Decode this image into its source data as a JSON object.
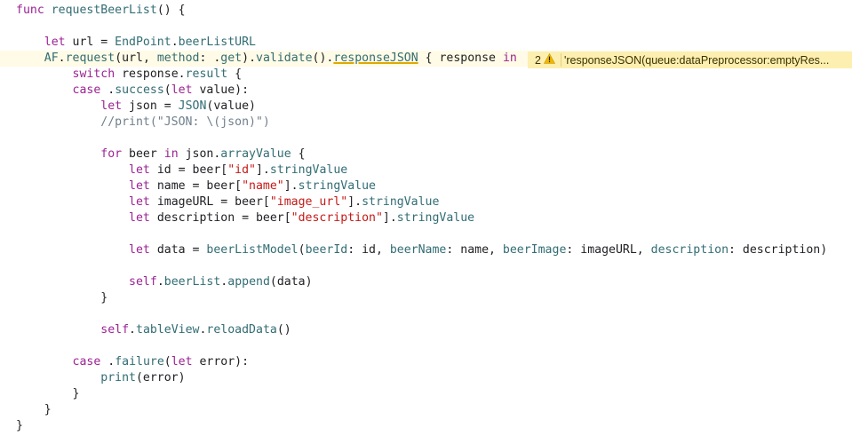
{
  "code_lines": [
    [
      [
        "kw",
        "func"
      ],
      [
        "p",
        " "
      ],
      [
        "fn",
        "requestBeerList"
      ],
      [
        "p",
        "() {"
      ]
    ],
    [],
    [
      [
        "p",
        "    "
      ],
      [
        "kw",
        "let"
      ],
      [
        "p",
        " url = "
      ],
      [
        "fn",
        "EndPoint"
      ],
      [
        "p",
        "."
      ],
      [
        "fn",
        "beerListURL"
      ]
    ],
    [
      [
        "p",
        "    "
      ],
      [
        "fn",
        "AF"
      ],
      [
        "p",
        "."
      ],
      [
        "fn",
        "request"
      ],
      [
        "p",
        "(url, "
      ],
      [
        "fn",
        "method"
      ],
      [
        "p",
        ": ."
      ],
      [
        "fn",
        "get"
      ],
      [
        "p",
        ")."
      ],
      [
        "fn",
        "validate"
      ],
      [
        "p",
        "()."
      ],
      [
        "fnw",
        "responseJSON"
      ],
      [
        "p",
        " { response "
      ],
      [
        "kw",
        "in"
      ]
    ],
    [
      [
        "p",
        "        "
      ],
      [
        "kw",
        "switch"
      ],
      [
        "p",
        " response."
      ],
      [
        "fn",
        "result"
      ],
      [
        "p",
        " {"
      ]
    ],
    [
      [
        "p",
        "        "
      ],
      [
        "kw",
        "case"
      ],
      [
        "p",
        " ."
      ],
      [
        "fn",
        "success"
      ],
      [
        "p",
        "("
      ],
      [
        "kw",
        "let"
      ],
      [
        "p",
        " value):"
      ]
    ],
    [
      [
        "p",
        "            "
      ],
      [
        "kw",
        "let"
      ],
      [
        "p",
        " json = "
      ],
      [
        "fn",
        "JSON"
      ],
      [
        "p",
        "(value)"
      ]
    ],
    [
      [
        "cm",
        "            //print(\"JSON: \\(json)\")"
      ]
    ],
    [],
    [
      [
        "p",
        "            "
      ],
      [
        "kw",
        "for"
      ],
      [
        "p",
        " beer "
      ],
      [
        "kw",
        "in"
      ],
      [
        "p",
        " json."
      ],
      [
        "fn",
        "arrayValue"
      ],
      [
        "p",
        " {"
      ]
    ],
    [
      [
        "p",
        "                "
      ],
      [
        "kw",
        "let"
      ],
      [
        "p",
        " id = beer["
      ],
      [
        "str",
        "\"id\""
      ],
      [
        "p",
        "]."
      ],
      [
        "fn",
        "stringValue"
      ]
    ],
    [
      [
        "p",
        "                "
      ],
      [
        "kw",
        "let"
      ],
      [
        "p",
        " name = beer["
      ],
      [
        "str",
        "\"name\""
      ],
      [
        "p",
        "]."
      ],
      [
        "fn",
        "stringValue"
      ]
    ],
    [
      [
        "p",
        "                "
      ],
      [
        "kw",
        "let"
      ],
      [
        "p",
        " imageURL = beer["
      ],
      [
        "str",
        "\"image_url\""
      ],
      [
        "p",
        "]."
      ],
      [
        "fn",
        "stringValue"
      ]
    ],
    [
      [
        "p",
        "                "
      ],
      [
        "kw",
        "let"
      ],
      [
        "p",
        " description = beer["
      ],
      [
        "str",
        "\"description\""
      ],
      [
        "p",
        "]."
      ],
      [
        "fn",
        "stringValue"
      ]
    ],
    [],
    [
      [
        "p",
        "                "
      ],
      [
        "kw",
        "let"
      ],
      [
        "p",
        " data = "
      ],
      [
        "fn",
        "beerListModel"
      ],
      [
        "p",
        "("
      ],
      [
        "fn",
        "beerId"
      ],
      [
        "p",
        ": id, "
      ],
      [
        "fn",
        "beerName"
      ],
      [
        "p",
        ": name, "
      ],
      [
        "fn",
        "beerImage"
      ],
      [
        "p",
        ": imageURL, "
      ],
      [
        "fn",
        "description"
      ],
      [
        "p",
        ": description)"
      ]
    ],
    [],
    [
      [
        "p",
        "                "
      ],
      [
        "kw",
        "self"
      ],
      [
        "p",
        "."
      ],
      [
        "fn",
        "beerList"
      ],
      [
        "p",
        "."
      ],
      [
        "fn",
        "append"
      ],
      [
        "p",
        "(data)"
      ]
    ],
    [
      [
        "p",
        "            }"
      ]
    ],
    [],
    [
      [
        "p",
        "            "
      ],
      [
        "kw",
        "self"
      ],
      [
        "p",
        "."
      ],
      [
        "fn",
        "tableView"
      ],
      [
        "p",
        "."
      ],
      [
        "fn",
        "reloadData"
      ],
      [
        "p",
        "()"
      ]
    ],
    [],
    [
      [
        "p",
        "        "
      ],
      [
        "kw",
        "case"
      ],
      [
        "p",
        " ."
      ],
      [
        "fn",
        "failure"
      ],
      [
        "p",
        "("
      ],
      [
        "kw",
        "let"
      ],
      [
        "p",
        " error):"
      ]
    ],
    [
      [
        "p",
        "            "
      ],
      [
        "fn",
        "print"
      ],
      [
        "p",
        "(error)"
      ]
    ],
    [
      [
        "p",
        "        }"
      ]
    ],
    [
      [
        "p",
        "    }"
      ]
    ],
    [
      [
        "p",
        "}"
      ]
    ]
  ],
  "highlighted_line": 4,
  "warning": {
    "count": "2",
    "icon": "warning-triangle-icon",
    "message": "'responseJSON(queue:dataPreprocessor:emptyRes...",
    "color": "#fcefb0"
  },
  "colors": {
    "keyword": "#9b2393",
    "identifier": "#326d74",
    "string": "#c41a16",
    "comment": "#707f8c",
    "plain": "#1f1f24"
  }
}
